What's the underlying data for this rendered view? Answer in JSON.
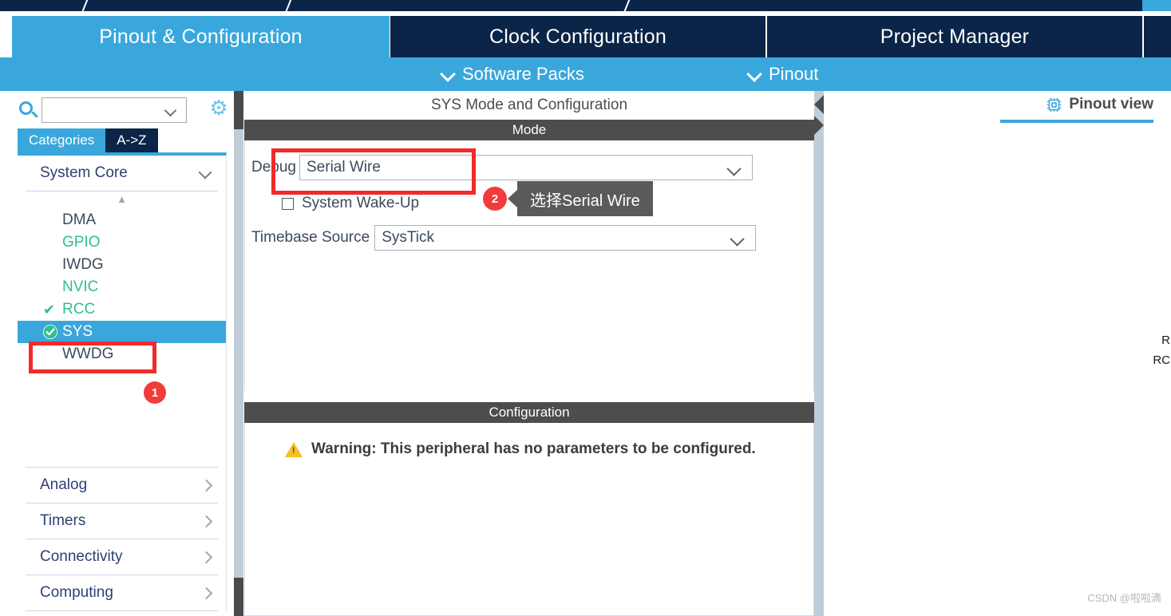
{
  "topbar": {
    "diagonal_dividers": 3
  },
  "tabs": [
    {
      "id": "pinout-configuration",
      "label": "Pinout & Configuration",
      "active": true
    },
    {
      "id": "clock-configuration",
      "label": "Clock Configuration",
      "active": false
    },
    {
      "id": "project-manager",
      "label": "Project Manager",
      "active": false
    }
  ],
  "subbar": {
    "software_packs": "Software Packs",
    "pinout": "Pinout"
  },
  "sidebar": {
    "search": {
      "value": "",
      "placeholder": ""
    },
    "gear_icon": "gear-icon",
    "mode_tabs": [
      {
        "label": "Categories",
        "active": true
      },
      {
        "label": "A->Z",
        "active": false
      }
    ],
    "category": {
      "label": "System Core",
      "expanded": true
    },
    "peripherals": [
      {
        "label": "DMA",
        "state": "none",
        "selected": false
      },
      {
        "label": "GPIO",
        "state": "available",
        "selected": false
      },
      {
        "label": "IWDG",
        "state": "none",
        "selected": false
      },
      {
        "label": "NVIC",
        "state": "available",
        "selected": false
      },
      {
        "label": "RCC",
        "state": "checked",
        "selected": false
      },
      {
        "label": "SYS",
        "state": "configured",
        "selected": true
      },
      {
        "label": "WWDG",
        "state": "none",
        "selected": false
      }
    ],
    "other_categories": [
      {
        "label": "Analog"
      },
      {
        "label": "Timers"
      },
      {
        "label": "Connectivity"
      },
      {
        "label": "Computing"
      }
    ]
  },
  "center": {
    "panel_title": "SYS Mode and Configuration",
    "mode_header": "Mode",
    "debug_label": "Debug",
    "debug_value": "Serial Wire",
    "wakeup_label": "System Wake-Up",
    "wakeup_checked": false,
    "timebase_label": "Timebase Source",
    "timebase_value": "SysTick",
    "config_header": "Configuration",
    "warning_text": "Warning: This peripheral has no parameters to be configured."
  },
  "right": {
    "pinout_view_label": "Pinout view",
    "chip_icon": "chip-icon",
    "pin_labels": [
      "R",
      "RC"
    ]
  },
  "annotations": [
    {
      "id": "1",
      "badge": "1",
      "target": "SYS",
      "callout": ""
    },
    {
      "id": "2",
      "badge": "2",
      "target": "Debug",
      "callout": "选择Serial Wire"
    }
  ],
  "watermark": "CSDN @啦啦滴",
  "colors": {
    "navy": "#0b2548",
    "accent_blue": "#3aa7dc",
    "dark_header": "#4d4d4d",
    "annotation_red": "#ef2b2b",
    "badge_red": "#f23b3b",
    "green": "#2fc08b",
    "warn_yellow": "#f5c022"
  }
}
